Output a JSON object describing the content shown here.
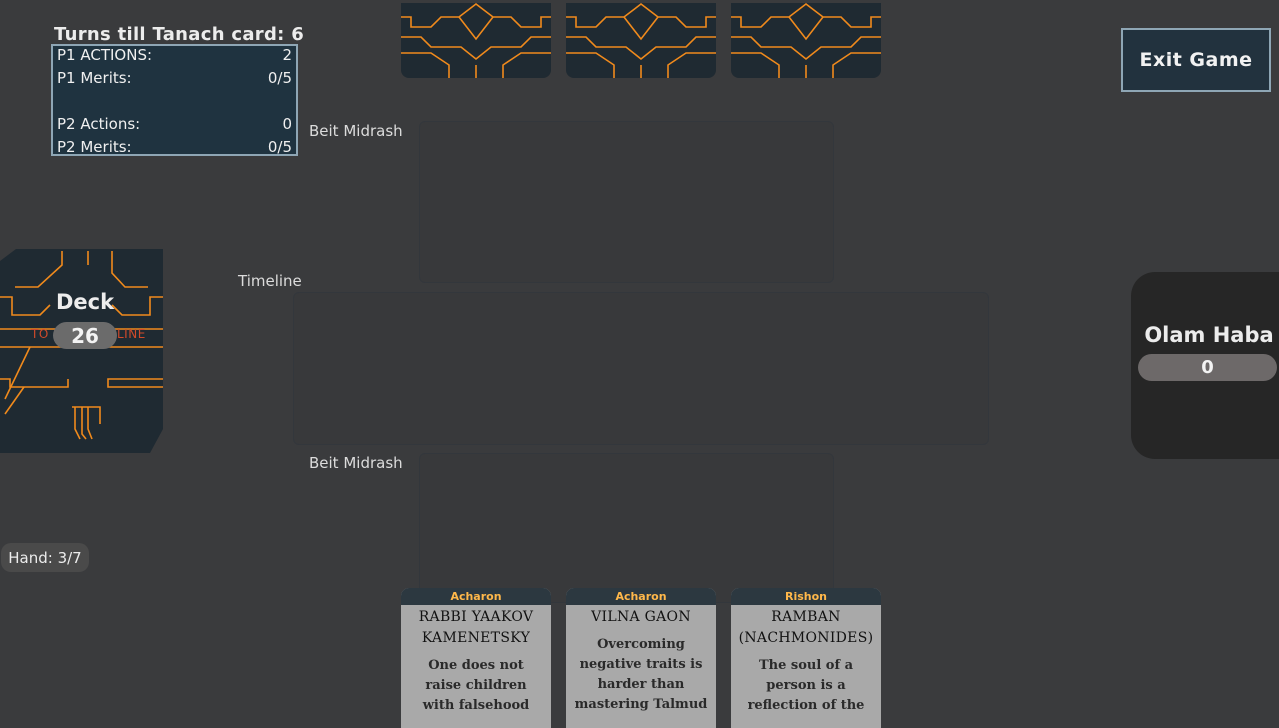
{
  "status": {
    "turns_title": "Turns till Tanach card: 6",
    "p1_actions_label": "P1 ACTIONS:",
    "p1_actions_value": "2",
    "p1_merits_label": "P1 Merits:",
    "p1_merits_value": "0/5",
    "p2_actions_label": "P2 Actions:",
    "p2_actions_value": "0",
    "p2_merits_label": "P2 Merits:",
    "p2_merits_value": "0/5"
  },
  "exit_label": "Exit Game",
  "zones": {
    "beit_midrash_top_label": "Beit Midrash",
    "timeline_label": "Timeline",
    "beit_midrash_bottom_label": "Beit Midrash"
  },
  "deck": {
    "title": "Deck",
    "count": "26",
    "back_text_left": "TO",
    "back_text_right": "LINE"
  },
  "olam_haba": {
    "title": "Olam Haba",
    "count": "0"
  },
  "hand": {
    "badge": "Hand: 3/7",
    "cards": [
      {
        "era": "Acharon",
        "name": "RABBI YAAKOV KAMENETSKY",
        "quote": "One does not raise children with falsehood"
      },
      {
        "era": "Acharon",
        "name": "VILNA GAON",
        "quote": "Overcoming negative traits is harder than mastering Talmud"
      },
      {
        "era": "Rishon",
        "name": "RAMBAN (NACHMONIDES)",
        "quote": "The soul of a person is a reflection of the"
      }
    ]
  },
  "colors": {
    "background": "#3a3b3d",
    "circuit_orange": "#f08a1c",
    "panel_blue": "#1f3340",
    "card_back": "#1f2a32",
    "era_text": "#ffb84a"
  },
  "icons": {
    "card_back_pattern": "circuit-pattern-icon"
  }
}
